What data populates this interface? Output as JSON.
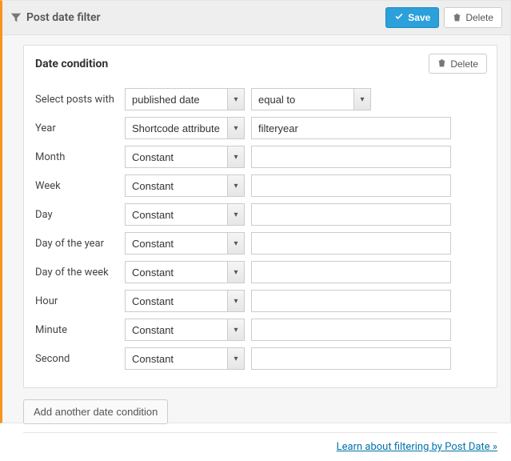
{
  "header": {
    "title": "Post date filter",
    "save_label": "Save",
    "delete_label": "Delete"
  },
  "condition": {
    "title": "Date condition",
    "delete_label": "Delete",
    "select_with_label": "Select posts with",
    "date_field": "published date",
    "compare": "equal to",
    "rows": [
      {
        "label": "Year",
        "type": "Shortcode attribute",
        "value": "filteryear"
      },
      {
        "label": "Month",
        "type": "Constant",
        "value": ""
      },
      {
        "label": "Week",
        "type": "Constant",
        "value": ""
      },
      {
        "label": "Day",
        "type": "Constant",
        "value": ""
      },
      {
        "label": "Day of the year",
        "type": "Constant",
        "value": ""
      },
      {
        "label": "Day of the week",
        "type": "Constant",
        "value": ""
      },
      {
        "label": "Hour",
        "type": "Constant",
        "value": ""
      },
      {
        "label": "Minute",
        "type": "Constant",
        "value": ""
      },
      {
        "label": "Second",
        "type": "Constant",
        "value": ""
      }
    ]
  },
  "add_button": "Add another date condition",
  "learn_link": "Learn about filtering by Post Date »"
}
